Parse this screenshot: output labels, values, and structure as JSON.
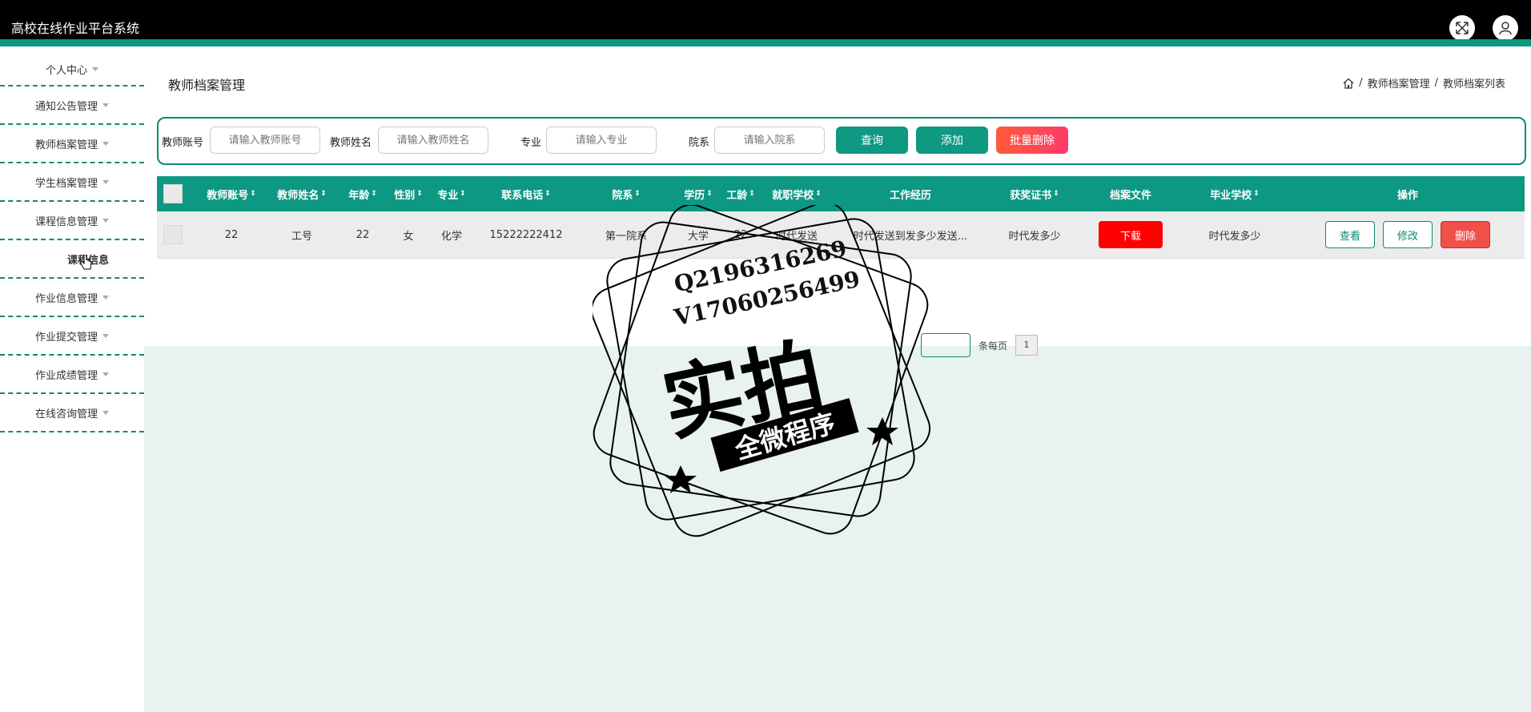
{
  "app": {
    "title": "高校在线作业平台系统"
  },
  "header_icons": [
    "fullscreen-icon",
    "user-icon"
  ],
  "sidebar": {
    "items": [
      {
        "label": "个人中心"
      },
      {
        "label": "通知公告管理"
      },
      {
        "label": "教师档案管理"
      },
      {
        "label": "学生档案管理"
      },
      {
        "label": "课程信息管理"
      },
      {
        "label": "课程信息"
      },
      {
        "label": "作业信息管理"
      },
      {
        "label": "作业提交管理"
      },
      {
        "label": "作业成绩管理"
      },
      {
        "label": "在线咨询管理"
      }
    ]
  },
  "page": {
    "title": "教师档案管理",
    "breadcrumb": [
      "教师档案管理",
      "教师档案列表"
    ],
    "breadcrumb_sep": "/"
  },
  "search": {
    "fields": [
      {
        "label": "教师账号",
        "placeholder": "请输入教师账号"
      },
      {
        "label": "教师姓名",
        "placeholder": "请输入教师姓名"
      },
      {
        "label": "专业",
        "placeholder": "请输入专业"
      },
      {
        "label": "院系",
        "placeholder": "请输入院系"
      }
    ],
    "query_label": "查询",
    "add_label": "添加",
    "batch_delete_label": "批量删除"
  },
  "table": {
    "columns": [
      "教师账号",
      "教师姓名",
      "年龄",
      "性别",
      "专业",
      "联系电话",
      "院系",
      "学历",
      "工龄",
      "就职学校",
      "工作经历",
      "获奖证书",
      "档案文件",
      "毕业学校",
      "操作"
    ],
    "rows": [
      {
        "account": "22",
        "name": "工号",
        "age": "22",
        "gender": "女",
        "major": "化学",
        "phone": "15222222412",
        "dept": "第一院系",
        "education": "大学",
        "years": "22",
        "school": "时代发送",
        "experience": "时代发送到发多少发送...",
        "award": "时代发多少",
        "download_label": "下载",
        "graduate_school": "时代发多少",
        "view_label": "查看",
        "edit_label": "修改",
        "delete_label": "删除"
      }
    ]
  },
  "pagination": {
    "per_page_label": "条每页",
    "page": "1"
  },
  "watermark": {
    "line1": "Q2196316269",
    "line2": "V17060256499",
    "big": "实拍",
    "band": "全微程序"
  }
}
